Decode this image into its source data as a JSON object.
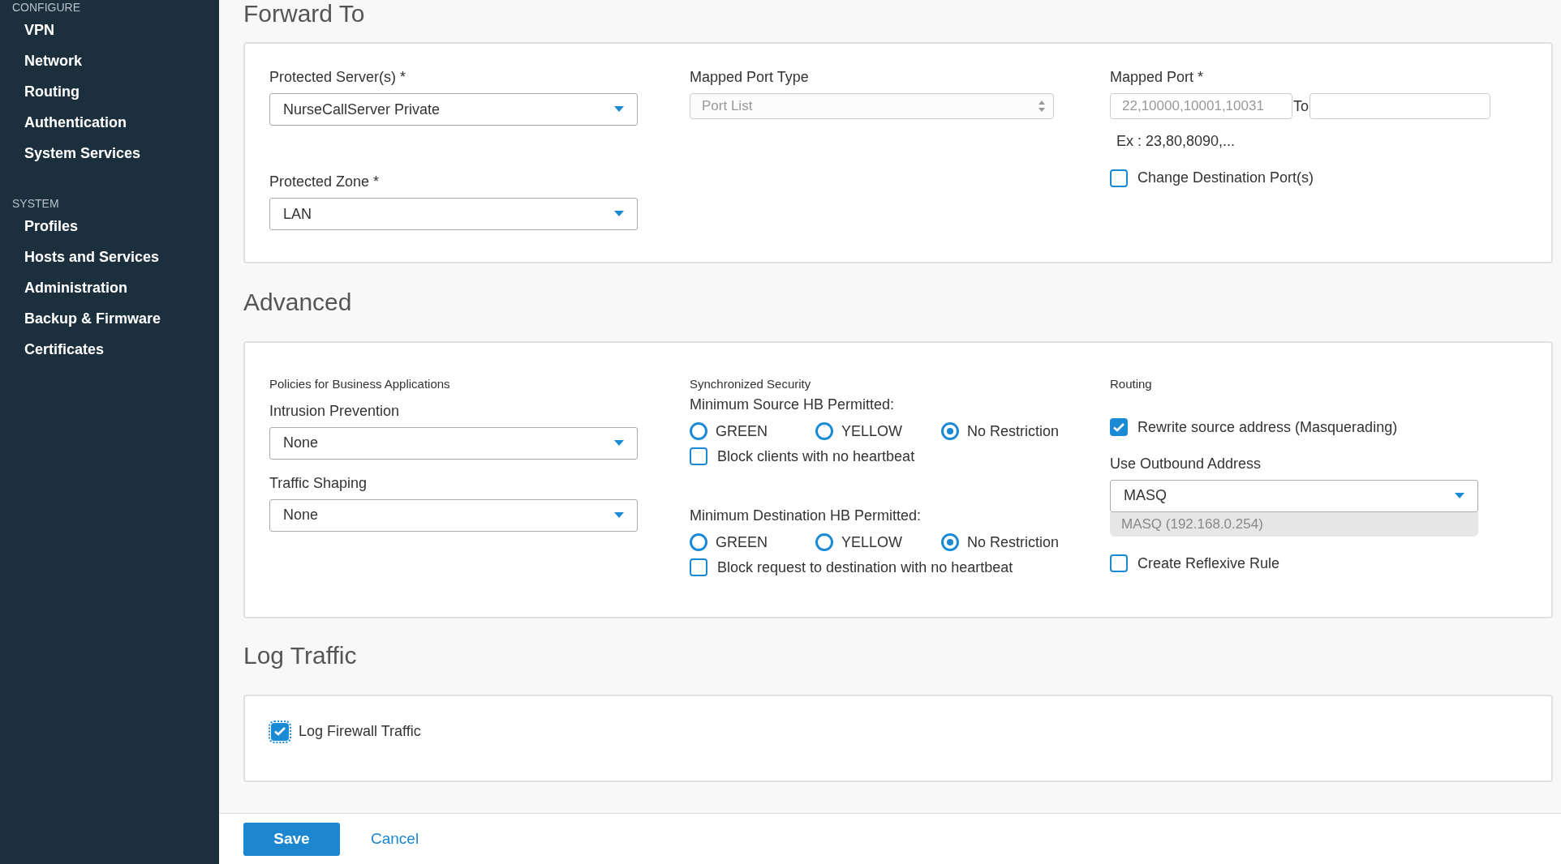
{
  "sidebar": {
    "sections": [
      {
        "heading": "CONFIGURE",
        "items": [
          {
            "label": "VPN"
          },
          {
            "label": "Network"
          },
          {
            "label": "Routing"
          },
          {
            "label": "Authentication"
          },
          {
            "label": "System Services"
          }
        ]
      },
      {
        "heading": "SYSTEM",
        "items": [
          {
            "label": "Profiles"
          },
          {
            "label": "Hosts and Services"
          },
          {
            "label": "Administration"
          },
          {
            "label": "Backup & Firmware"
          },
          {
            "label": "Certificates"
          }
        ]
      }
    ]
  },
  "forward_to": {
    "heading": "Forward To",
    "protected_servers": {
      "label": "Protected Server(s) *",
      "value": "NurseCallServer Private"
    },
    "protected_zone": {
      "label": "Protected Zone *",
      "value": "LAN"
    },
    "mapped_port_type": {
      "label": "Mapped Port Type",
      "value": "Port List",
      "disabled": true
    },
    "mapped_port": {
      "label": "Mapped Port *",
      "from_value": "22,10000,10001,10031",
      "to_label": "To",
      "example": "Ex : 23,80,8090,..."
    },
    "change_destination_ports": {
      "label": "Change Destination Port(s)",
      "checked": false
    }
  },
  "advanced": {
    "heading": "Advanced",
    "policies": {
      "heading": "Policies for Business Applications",
      "intrusion_prevention": {
        "label": "Intrusion Prevention",
        "value": "None"
      },
      "traffic_shaping": {
        "label": "Traffic Shaping",
        "value": "None"
      }
    },
    "synchronized_security": {
      "heading": "Synchronized Security",
      "groups": [
        {
          "label": "Minimum Source HB Permitted:",
          "options": [
            {
              "label": "GREEN",
              "selected": false
            },
            {
              "label": "YELLOW",
              "selected": false
            },
            {
              "label": "No Restriction",
              "selected": true
            }
          ],
          "block": {
            "label": "Block clients with no heartbeat",
            "checked": false
          }
        },
        {
          "label": "Minimum Destination HB Permitted:",
          "options": [
            {
              "label": "GREEN",
              "selected": false
            },
            {
              "label": "YELLOW",
              "selected": false
            },
            {
              "label": "No Restriction",
              "selected": true
            }
          ],
          "block": {
            "label": "Block request to destination with no heartbeat",
            "checked": false
          }
        }
      ]
    },
    "routing": {
      "heading": "Routing",
      "rewrite_source": {
        "label": "Rewrite source address (Masquerading)",
        "checked": true
      },
      "outbound_address": {
        "label": "Use Outbound Address",
        "value": "MASQ",
        "hint": "MASQ (192.168.0.254)"
      },
      "reflexive_rule": {
        "label": "Create Reflexive Rule",
        "checked": false
      }
    }
  },
  "log_traffic": {
    "heading": "Log Traffic",
    "log_firewall": {
      "label": "Log Firewall Traffic",
      "checked": true,
      "focused": true
    }
  },
  "footer": {
    "save": "Save",
    "cancel": "Cancel"
  }
}
